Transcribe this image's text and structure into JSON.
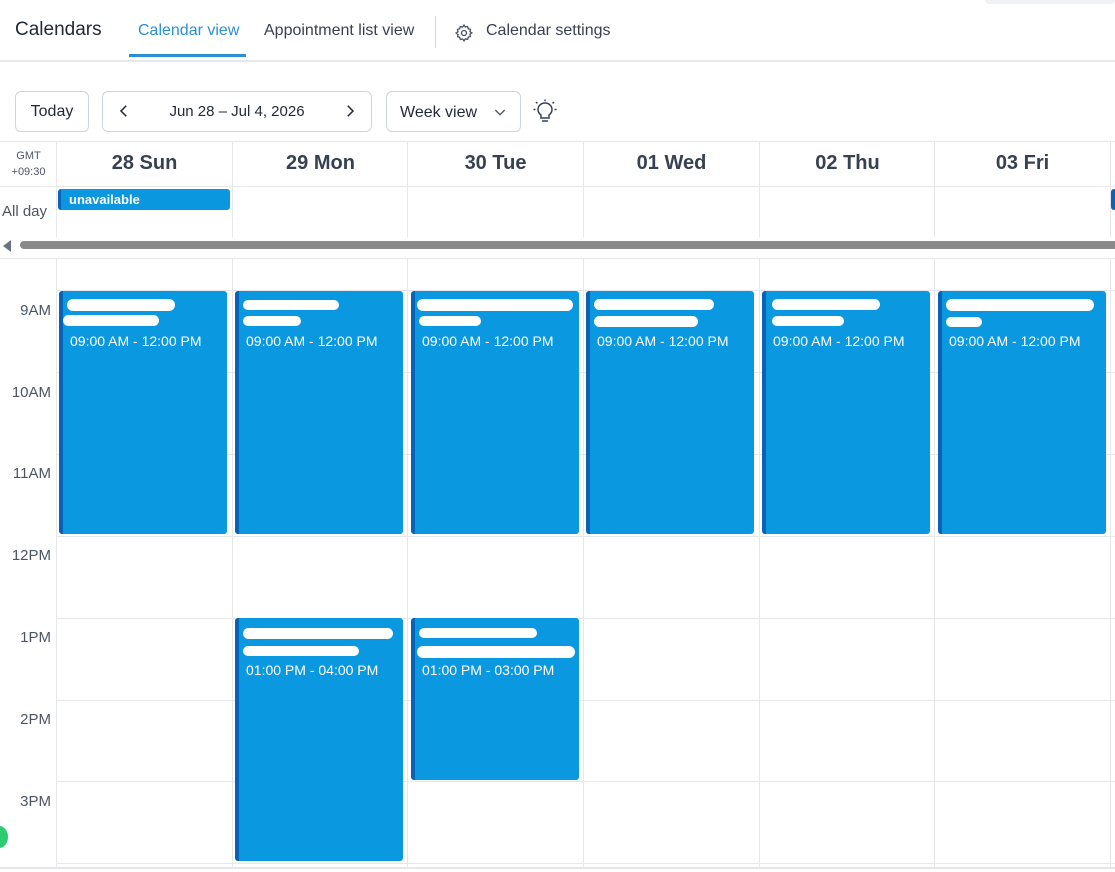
{
  "header": {
    "title": "Calendars",
    "tabs": [
      {
        "label": "Calendar view",
        "active": true
      },
      {
        "label": "Appointment list view",
        "active": false
      },
      {
        "label": "Calendar settings",
        "active": false,
        "icon": "gear-icon"
      }
    ]
  },
  "toolbar": {
    "today_label": "Today",
    "range_label": "Jun 28 – Jul 4, 2026",
    "view_label": "Week view",
    "theme_icon": "lightbulb-icon"
  },
  "grid": {
    "timezone_line1": "GMT",
    "timezone_line2": "+09:30",
    "allday_label": "All day",
    "days": [
      "28 Sun",
      "29 Mon",
      "30 Tue",
      "01 Wed",
      "02 Thu",
      "03 Fri"
    ],
    "hours": [
      "9AM",
      "10AM",
      "11AM",
      "12PM",
      "1PM",
      "2PM",
      "3PM"
    ],
    "allday_events": [
      {
        "day": "28 Sun",
        "label": "unavailable"
      }
    ]
  },
  "events": [
    {
      "day": "28 Sun",
      "time": "09:00 AM - 12:00 PM"
    },
    {
      "day": "29 Mon",
      "time": "09:00 AM - 12:00 PM"
    },
    {
      "day": "30 Tue",
      "time": "09:00 AM - 12:00 PM"
    },
    {
      "day": "01 Wed",
      "time": "09:00 AM - 12:00 PM"
    },
    {
      "day": "02 Thu",
      "time": "09:00 AM - 12:00 PM"
    },
    {
      "day": "03 Fri",
      "time": "09:00 AM - 12:00 PM"
    },
    {
      "day": "29 Mon",
      "time": "01:00 PM - 04:00 PM"
    },
    {
      "day": "30 Tue",
      "time": "01:00 PM - 03:00 PM"
    }
  ],
  "colors": {
    "accent": "#2b8fd6",
    "event_fill": "#0a98e1",
    "event_border": "#0a62b5"
  }
}
